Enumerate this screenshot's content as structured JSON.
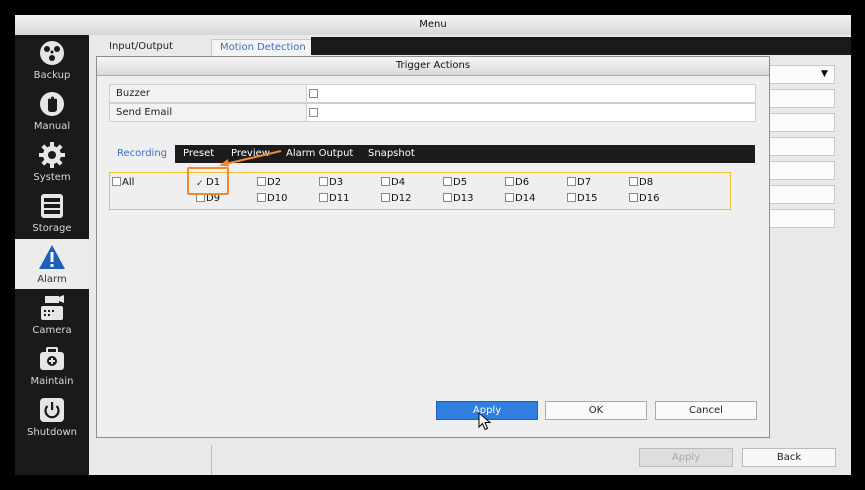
{
  "window": {
    "title": "Menu"
  },
  "sidebar": {
    "items": [
      {
        "label": "Backup",
        "icon": "backup-icon"
      },
      {
        "label": "Manual",
        "icon": "hand-icon"
      },
      {
        "label": "System",
        "icon": "gear-icon"
      },
      {
        "label": "Storage",
        "icon": "storage-icon"
      },
      {
        "label": "Alarm",
        "icon": "warning-icon",
        "active": true
      },
      {
        "label": "Camera",
        "icon": "camera-icon"
      },
      {
        "label": "Maintain",
        "icon": "toolbox-icon"
      },
      {
        "label": "Shutdown",
        "icon": "power-icon"
      }
    ]
  },
  "background": {
    "tabs": [
      "Input/Output",
      "Motion Detection"
    ],
    "apply_label": "Apply",
    "back_label": "Back"
  },
  "dialog": {
    "title": "Trigger Actions",
    "rows": [
      {
        "label": "Buzzer",
        "checked": false
      },
      {
        "label": "Send Email",
        "checked": false
      }
    ],
    "tabs": [
      "Recording",
      "Preset",
      "Preview",
      "Alarm Output",
      "Snapshot"
    ],
    "active_tab": "Recording",
    "all_label": "All",
    "channels": [
      "D1",
      "D2",
      "D3",
      "D4",
      "D5",
      "D6",
      "D7",
      "D8",
      "D9",
      "D10",
      "D11",
      "D12",
      "D13",
      "D14",
      "D15",
      "D16"
    ],
    "checked_channels": [
      "D1"
    ],
    "buttons": {
      "apply": "Apply",
      "ok": "OK",
      "cancel": "Cancel"
    }
  },
  "colors": {
    "accent": "#2f7ee0",
    "highlight": "#f08a30",
    "grid_border": "#f0c030",
    "sidebar_bg": "#1a1a1a"
  }
}
